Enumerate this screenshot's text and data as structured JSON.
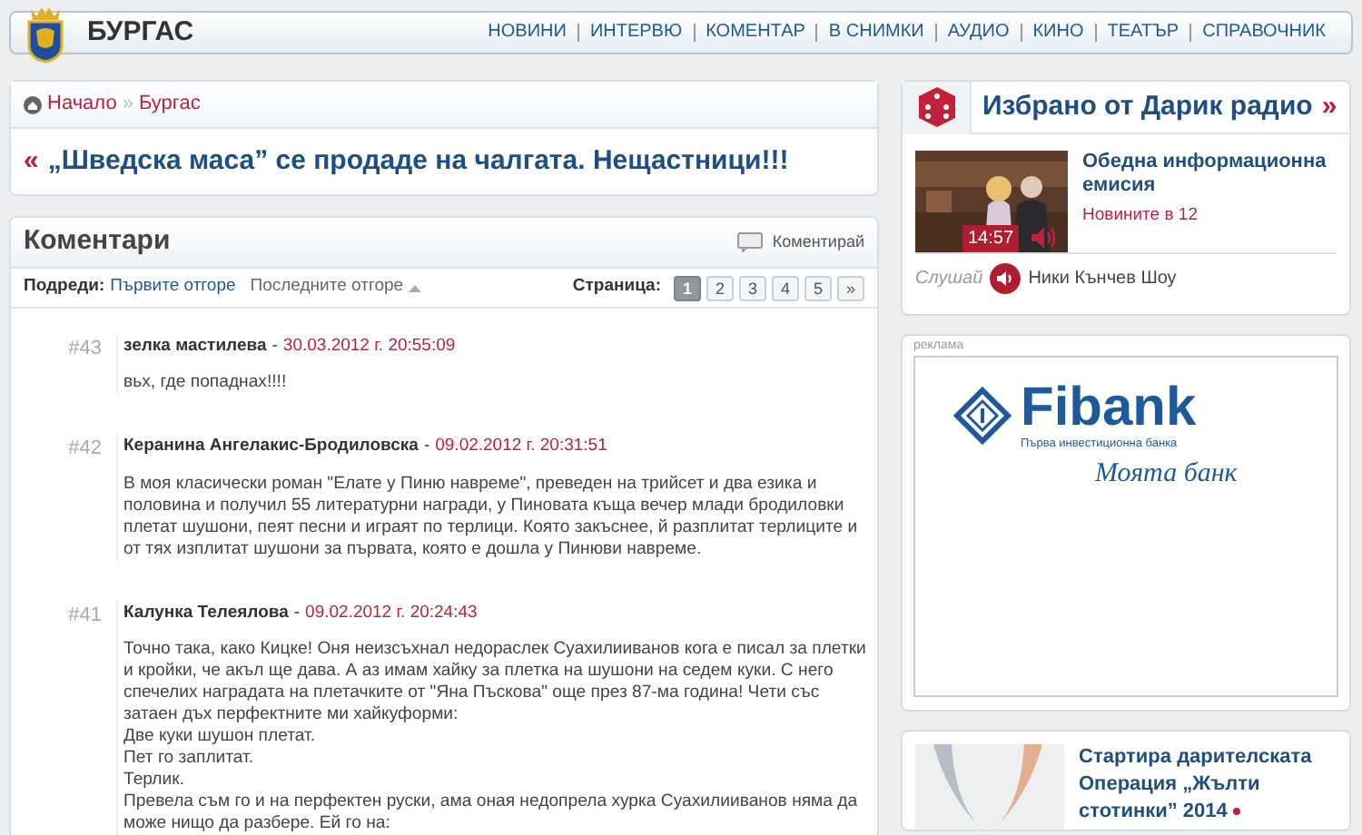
{
  "header": {
    "title": "БУРГАС",
    "nav": [
      {
        "label": "НОВИНИ"
      },
      {
        "label": "ИНТЕРВЮ"
      },
      {
        "label": "КОМЕНТАР"
      },
      {
        "label": "В СНИМКИ"
      },
      {
        "label": "АУДИО"
      },
      {
        "label": "КИНО"
      },
      {
        "label": "ТЕАТЪР"
      },
      {
        "label": "СПРАВОЧНИК"
      }
    ]
  },
  "breadcrumb": [
    {
      "label": "Начало"
    },
    {
      "label": "Бургас"
    }
  ],
  "breadcrumb_separator": "»",
  "article": {
    "back": "«",
    "title": "„Шведска маса” се продаде на чалгата. Нещастници!!!"
  },
  "comments": {
    "title": "Коментари",
    "comment_button": "Коментирай",
    "sort_label": "Подреди:",
    "sort_options": [
      {
        "label": "Първите отгоре",
        "selected": false
      },
      {
        "label": "Последните отгоре",
        "selected": true
      }
    ],
    "author_separator": "-",
    "page_label": "Страница:",
    "pages": [
      {
        "label": "1",
        "selected": true
      },
      {
        "label": "2",
        "selected": false
      },
      {
        "label": "3",
        "selected": false
      },
      {
        "label": "4",
        "selected": false
      },
      {
        "label": "5",
        "selected": false
      }
    ],
    "next": "»",
    "items": [
      {
        "number": "#43",
        "author": "зелка мастилева",
        "date": "30.03.2012 г. 20:55:09",
        "lines": [
          "вьх, где попаднах!!!!"
        ]
      },
      {
        "number": "#42",
        "author": "Керанина Ангелакис-Бродиловска",
        "date": "09.02.2012 г. 20:31:51",
        "lines": [
          "В моя класически роман \"Елате у Пиню навреме\", преведен на трийсет и два езика и половина и получил 55 литературни награди, у Пиновата къща вечер млади бродиловки плетат шушони, пеят песни и играят по терлици. Която закъснее, й разплитат терлиците и от тях изплитат шушони за първата, която е дошла у Пинюви навреме."
        ]
      },
      {
        "number": "#41",
        "author": "Калунка Телеялова",
        "date": "09.02.2012 г. 20:24:43",
        "lines": [
          "Точно така, како Кицке! Оня неизсъхнал недораслек Суахилииванов кога е писал за плетки и кройки, че акъл ще дава. А аз имам хайку за плетка на шушони на седем куки. С него спечелих наградата на плетачките от \"Яна Пъскова\" още през 87-ма година! Чети със затаен дъх перфектните ми хайкуформи:",
          "Две куки шушон плетат.",
          "Пет го заплитат.",
          "Терлик.",
          "Превела съм го и на перфектен руски, ама оная недопрела хурка Суахилииванов няма да може нищо да разбере. Ей го на:"
        ]
      }
    ]
  },
  "darik": {
    "title": "Избрано от Дарик радио",
    "more": "»",
    "item": {
      "kind": "picture",
      "duration": "14:57",
      "title": "Обедна информационна емисия",
      "subtitle": "Новините в 12"
    },
    "listen_label": "Слушай",
    "listen_show": "Ники Кънчев Шоу"
  },
  "ad": {
    "label": "реклама",
    "brand": "Fibank",
    "tagline": "Първа инвестиционна банка",
    "slogan": "Моята банк"
  },
  "promo": {
    "kind": "picture",
    "title": "Стартира дарителската Операция „Жълти стотинки” 2014"
  }
}
